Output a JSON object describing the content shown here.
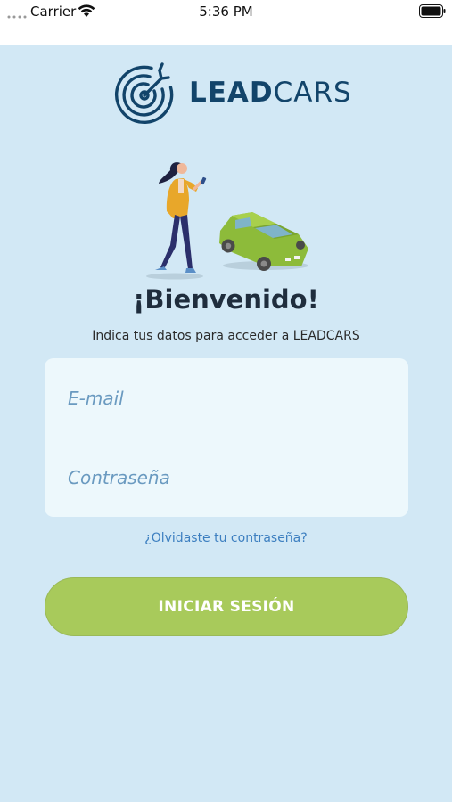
{
  "status_bar": {
    "carrier": "Carrier",
    "time": "5:36 PM"
  },
  "logo": {
    "bold_part": "LEAD",
    "light_part": "CARS"
  },
  "welcome": "¡Bienvenido!",
  "subtitle": "Indica tus datos para acceder a LEADCARS",
  "form": {
    "email_placeholder": "E-mail",
    "password_placeholder": "Contraseña"
  },
  "forgot_password": "¿Olvidaste tu contraseña?",
  "login_button": "INICIAR SESIÓN",
  "colors": {
    "background": "#d2e8f5",
    "brand_navy": "#12446a",
    "button_green": "#a8ca5b",
    "link_blue": "#3d7fc0"
  },
  "icons": [
    "signal-dots-icon",
    "wifi-icon",
    "battery-icon",
    "target-logo-icon"
  ]
}
